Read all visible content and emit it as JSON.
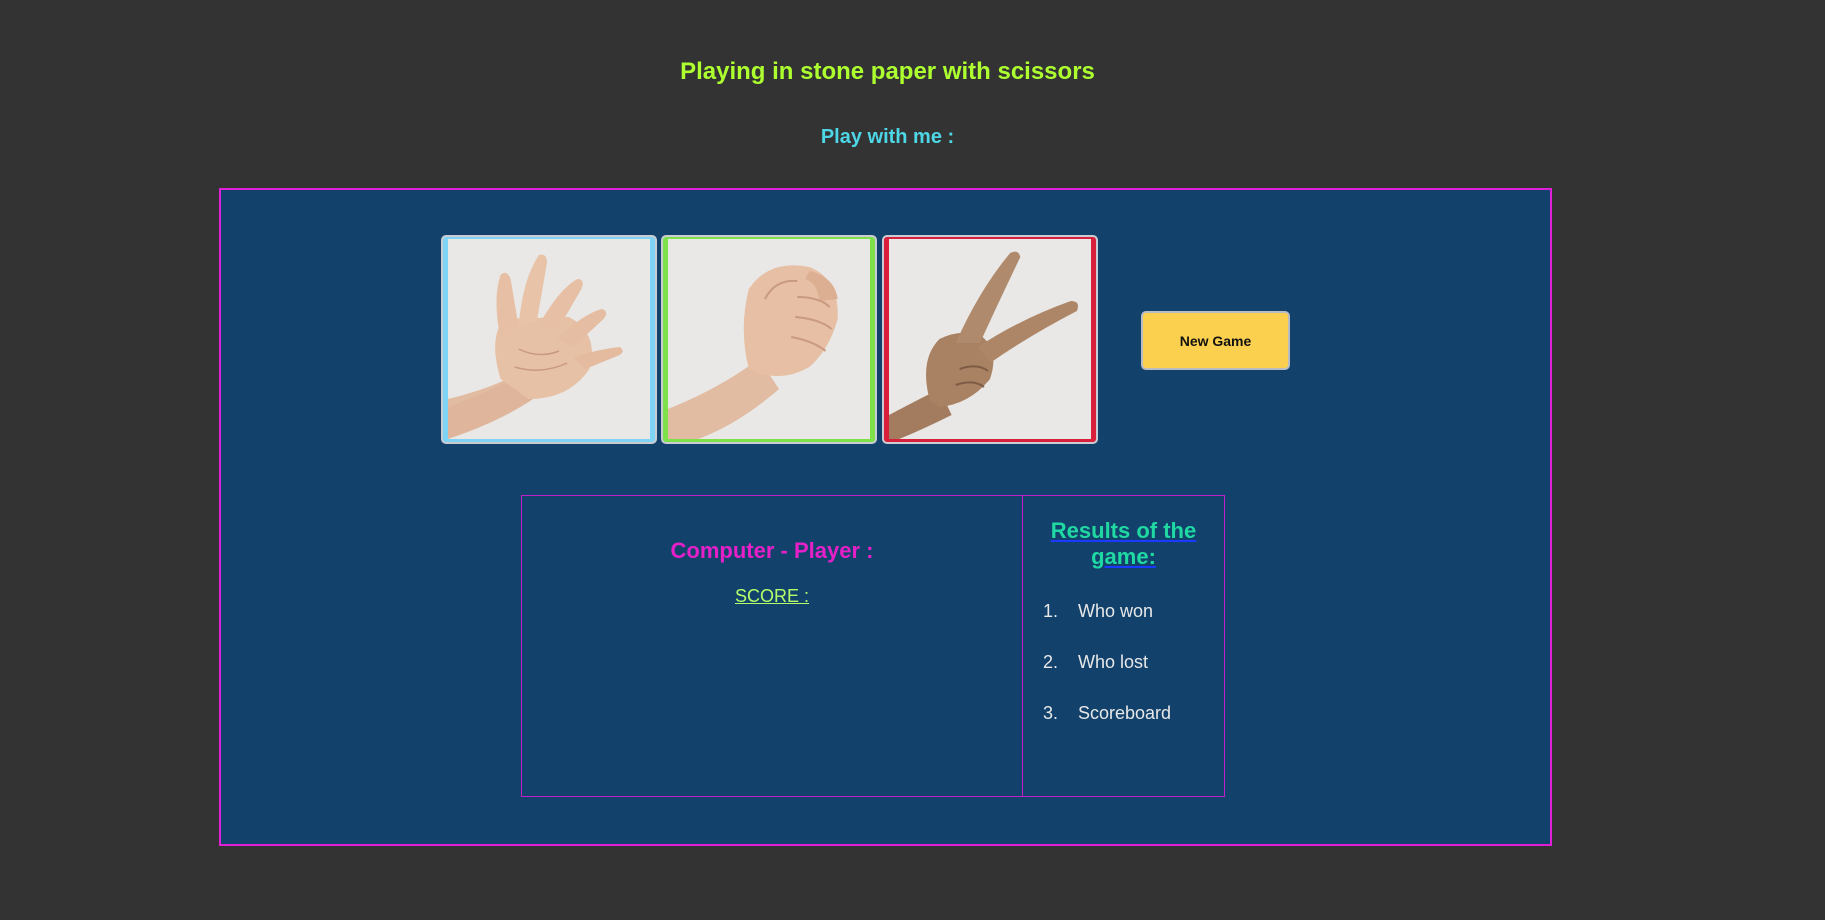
{
  "header": {
    "title": "Playing in stone paper with scissors",
    "subtitle": "Play with me :"
  },
  "choices": [
    {
      "name": "paper",
      "icon": "open-hand-icon",
      "border_color": "#7fd3f5"
    },
    {
      "name": "rock",
      "icon": "fist-icon",
      "border_color": "#7fe14a"
    },
    {
      "name": "scissors",
      "icon": "peace-hand-icon",
      "border_color": "#d8203c"
    }
  ],
  "controls": {
    "new_game_label": "New Game"
  },
  "score_panel": {
    "heading": "Computer - Player :",
    "score_label": "SCORE :"
  },
  "results_panel": {
    "heading": "Results of the game:",
    "items": [
      {
        "num": "1.",
        "label": "Who won"
      },
      {
        "num": "2.",
        "label": "Who lost"
      },
      {
        "num": "3.",
        "label": "Scoreboard"
      }
    ]
  },
  "colors": {
    "background": "#333333",
    "panel": "#12426c",
    "panel_border": "#e020d8",
    "title": "#adff2f",
    "subtitle": "#4dd6e6",
    "button": "#fcd04f"
  }
}
